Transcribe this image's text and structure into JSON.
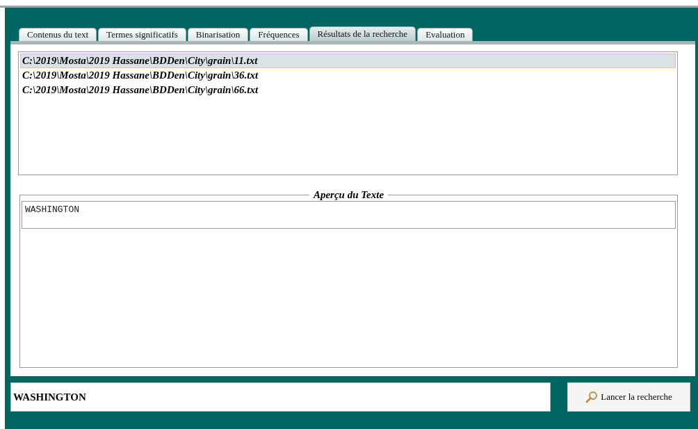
{
  "tabs": [
    {
      "label": "Contenus du text",
      "selected": false
    },
    {
      "label": "Termes significatifs",
      "selected": false
    },
    {
      "label": "Binarisation",
      "selected": false
    },
    {
      "label": "Fréquences",
      "selected": false
    },
    {
      "label": "Résultats de la recherche",
      "selected": true
    },
    {
      "label": "Evaluation",
      "selected": false
    }
  ],
  "results": [
    {
      "path": "C:\\2019\\Mosta\\2019 Hassane\\BDDen\\City\\grain\\11.txt",
      "selected": true
    },
    {
      "path": "C:\\2019\\Mosta\\2019 Hassane\\BDDen\\City\\grain\\36.txt",
      "selected": false
    },
    {
      "path": "C:\\2019\\Mosta\\2019 Hassane\\BDDen\\City\\grain\\66.txt",
      "selected": false
    }
  ],
  "preview": {
    "title": "Aperçu du Texte",
    "text": "WASHINGTON"
  },
  "search": {
    "value": "WASHINGTON"
  },
  "button": {
    "label": "Lancer la recherche"
  }
}
